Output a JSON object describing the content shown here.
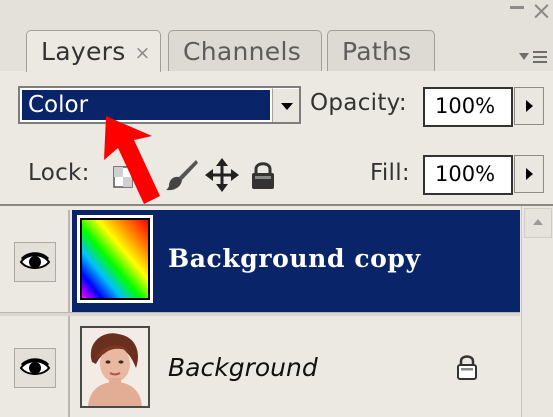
{
  "tabs": [
    {
      "label": "Layers",
      "close": "×",
      "active": true
    },
    {
      "label": "Channels",
      "active": false
    },
    {
      "label": "Paths",
      "active": false
    }
  ],
  "window": {
    "minimize_icon": "minimize-icon",
    "close_glyph": "×"
  },
  "blend_mode": {
    "value": "Color"
  },
  "opacity": {
    "label": "Opacity:",
    "value": "100%"
  },
  "lock": {
    "label": "Lock:",
    "icons": [
      "lock-transparent-icon",
      "lock-paint-icon",
      "lock-move-icon",
      "lock-all-icon"
    ]
  },
  "fill": {
    "label": "Fill:",
    "value": "100%"
  },
  "layers": [
    {
      "name": "Background copy",
      "selected": true,
      "visible": true,
      "thumbnail": "rainbow-gradient"
    },
    {
      "name": "Background",
      "selected": false,
      "visible": true,
      "locked": true,
      "thumbnail": "portrait-photo"
    }
  ],
  "colors": {
    "selection": "#0a246a",
    "panel": "#ebe9e1",
    "annotation_arrow": "#ff0000"
  }
}
